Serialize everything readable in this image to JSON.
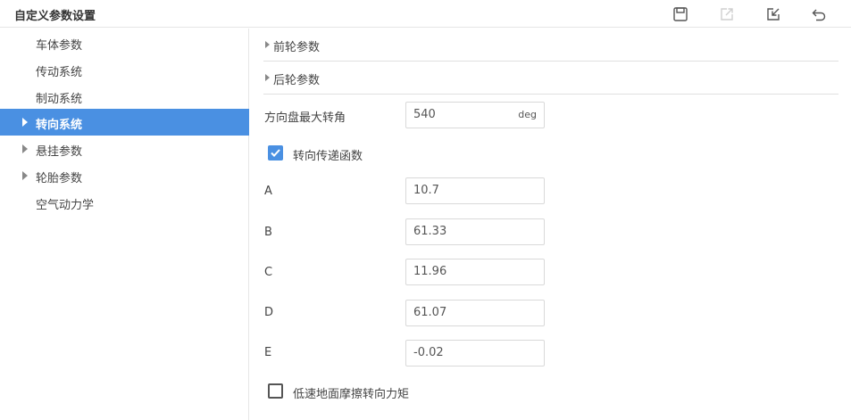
{
  "header": {
    "title": "自定义参数设置"
  },
  "toolbar": {
    "save_icon": "save-icon",
    "export_icon": "export-icon",
    "import_icon": "import-icon",
    "undo_icon": "undo-icon"
  },
  "sidebar": {
    "items": [
      {
        "label": "车体参数",
        "expandable": false,
        "active": false
      },
      {
        "label": "传动系统",
        "expandable": false,
        "active": false
      },
      {
        "label": "制动系统",
        "expandable": false,
        "active": false
      },
      {
        "label": "转向系统",
        "expandable": true,
        "active": true
      },
      {
        "label": "悬挂参数",
        "expandable": true,
        "active": false
      },
      {
        "label": "轮胎参数",
        "expandable": true,
        "active": false
      },
      {
        "label": "空气动力学",
        "expandable": false,
        "active": false
      }
    ]
  },
  "main": {
    "sections": [
      {
        "label": "前轮参数"
      },
      {
        "label": "后轮参数"
      }
    ],
    "steering_max_angle": {
      "label": "方向盘最大转角",
      "value": "540",
      "unit": "deg"
    },
    "transfer_function": {
      "label": "转向传递函数",
      "checked": true
    },
    "params": [
      {
        "label": "A",
        "value": "10.7"
      },
      {
        "label": "B",
        "value": "61.33"
      },
      {
        "label": "C",
        "value": "11.96"
      },
      {
        "label": "D",
        "value": "61.07"
      },
      {
        "label": "E",
        "value": "-0.02"
      }
    ],
    "low_speed_friction": {
      "label": "低速地面摩擦转向力矩",
      "checked": false
    }
  },
  "colors": {
    "accent": "#4a90e2",
    "border": "#d9d9d9"
  }
}
